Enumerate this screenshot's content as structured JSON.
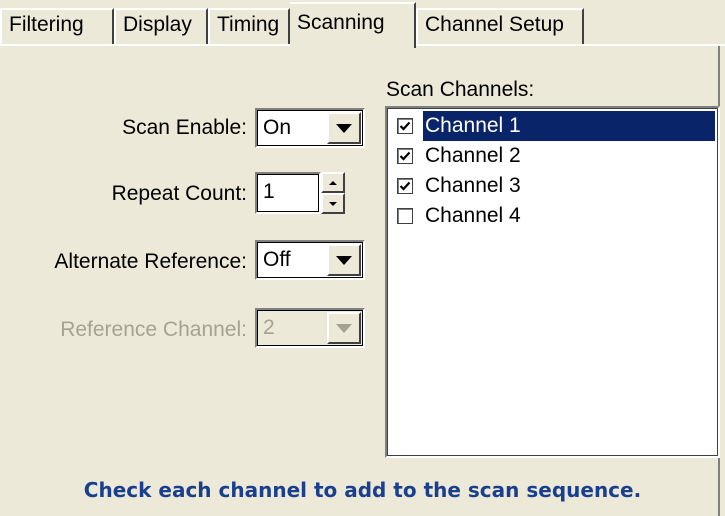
{
  "tabs": [
    {
      "label": "Filtering"
    },
    {
      "label": "Display"
    },
    {
      "label": "Timing"
    },
    {
      "label": "Scanning",
      "active": true
    },
    {
      "label": "Channel Setup"
    }
  ],
  "scanning": {
    "scan_enable": {
      "label": "Scan Enable:",
      "value": "On"
    },
    "repeat_count": {
      "label": "Repeat Count:",
      "value": "1"
    },
    "alternate_reference": {
      "label": "Alternate Reference:",
      "value": "Off"
    },
    "reference_channel": {
      "label": "Reference Channel:",
      "value": "2",
      "disabled": true
    }
  },
  "scan_channels": {
    "heading": "Scan Channels:",
    "items": [
      {
        "label": "Channel 1",
        "checked": true,
        "selected": true
      },
      {
        "label": "Channel 2",
        "checked": true,
        "selected": false
      },
      {
        "label": "Channel 3",
        "checked": true,
        "selected": false
      },
      {
        "label": "Channel 4",
        "checked": false,
        "selected": false
      }
    ]
  },
  "hint": "Check each channel to add to the scan sequence.",
  "colors": {
    "panel_bg": "#ece9d8",
    "selection": "#0a246a",
    "hint_text": "#1a3f8f",
    "disabled_text": "#a5a294"
  }
}
